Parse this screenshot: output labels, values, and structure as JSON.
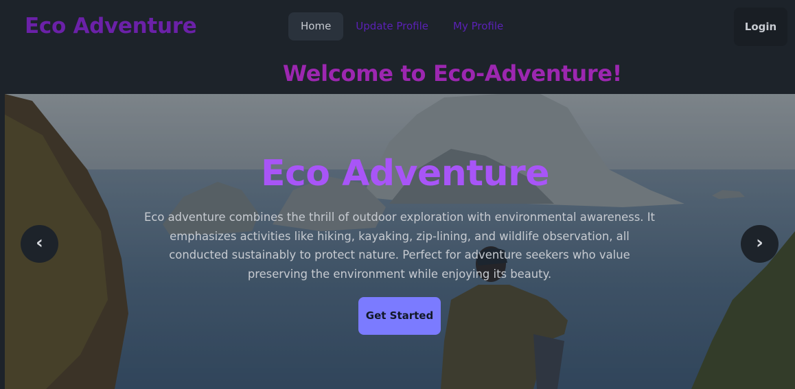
{
  "navbar": {
    "brand": "Eco Adventure",
    "links": [
      {
        "label": "Home",
        "active": true
      },
      {
        "label": "Update Profile",
        "active": false
      },
      {
        "label": "My Profile",
        "active": false
      }
    ],
    "login_label": "Login"
  },
  "welcome_heading": "Welcome to Eco-Adventure!",
  "hero": {
    "title": "Eco Adventure",
    "description": "Eco adventure combines the thrill of outdoor exploration with environmental awareness. It emphasizes activities like hiking, kayaking, zip-lining, and wildlife observation, all conducted sustainably to protect nature. Perfect for adventure seekers who value preserving the environment while enjoying its beauty.",
    "cta_label": "Get Started",
    "prev_icon": "chevron-left-icon",
    "next_icon": "chevron-right-icon",
    "prev_glyph": "‹",
    "next_glyph": "›"
  },
  "colors": {
    "background": "#1d232a",
    "brand": "#6b21a8",
    "nav_link": "#5b21b6",
    "welcome": "#9c27b0",
    "hero_title": "#a855f7",
    "cta": "#7b7bff"
  }
}
